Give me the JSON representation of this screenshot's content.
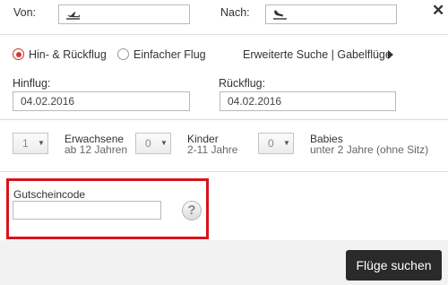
{
  "route": {
    "from_label": "Von:",
    "to_label": "Nach:",
    "from_value": "",
    "to_value": "",
    "from_icon": "plane-departure-icon",
    "to_icon": "plane-arrival-icon",
    "close_symbol": "✕"
  },
  "trip_type": {
    "round_trip_label": "Hin- & Rückflug",
    "one_way_label": "Einfacher Flug",
    "selected": "round_trip",
    "advanced_link": "Erweiterte Suche | Gabelflüge",
    "accent_color": "#d8372b"
  },
  "dates": {
    "outbound_label": "Hinflug:",
    "outbound_value": "04.02.2016",
    "return_label": "Rückflug:",
    "return_value": "04.02.2016"
  },
  "passengers": {
    "adults": {
      "value": "1",
      "title": "Erwachsene",
      "sub": "ab 12 Jahren"
    },
    "children": {
      "value": "0",
      "title": "Kinder",
      "sub": "2-11 Jahre"
    },
    "infants": {
      "value": "0",
      "title": "Babies",
      "sub": "unter 2 Jahre (ohne Sitz)"
    }
  },
  "voucher": {
    "label": "Gutscheincode",
    "value": "",
    "help_symbol": "?",
    "highlight_color": "#d9131c"
  },
  "footer": {
    "search_label": "Flüge suchen",
    "button_color": "#2a2a2a"
  }
}
